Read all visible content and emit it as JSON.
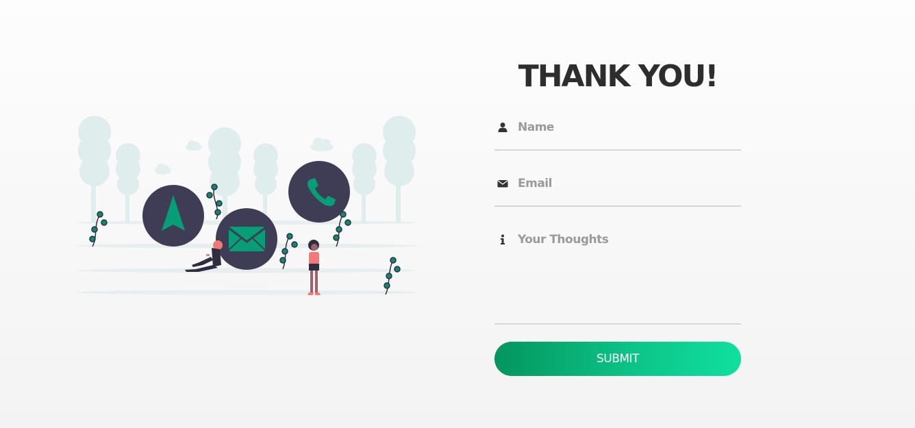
{
  "form": {
    "title": "THANK YOU!",
    "name_placeholder": "Name",
    "email_placeholder": "Email",
    "thoughts_placeholder": "Your Thoughts",
    "submit_label": "SUBMIT"
  },
  "icons": {
    "name": "user-icon",
    "email": "envelope-icon",
    "thoughts": "info-icon",
    "illustration": [
      "navigation-arrow-icon",
      "mail-icon",
      "phone-icon"
    ]
  },
  "colors": {
    "accent_start": "#04955f",
    "accent_end": "#10df9e",
    "icon_circle": "#3f3d56",
    "icon_glyph": "#069e76",
    "title": "#2d2d2d",
    "placeholder": "#9a9a9a"
  }
}
